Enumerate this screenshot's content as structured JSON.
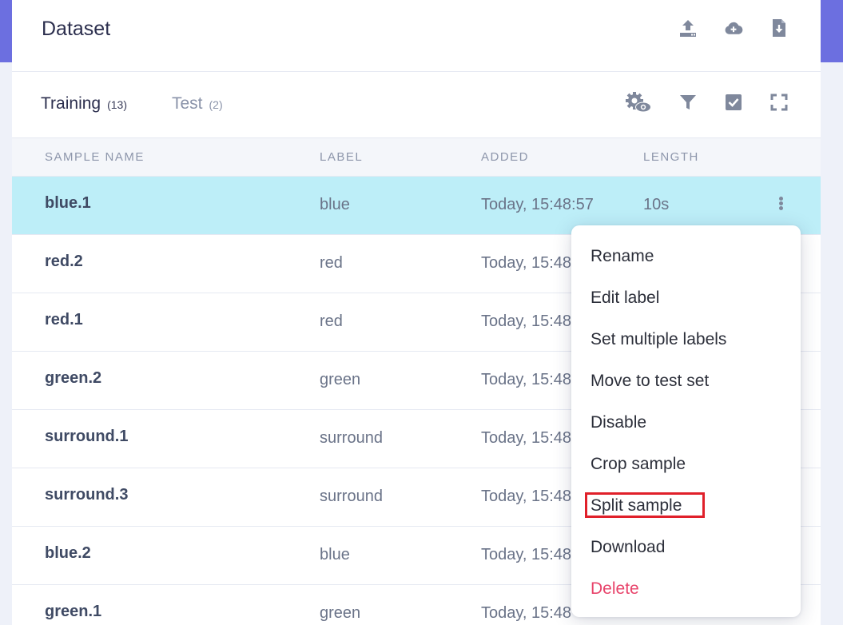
{
  "header": {
    "title": "Dataset",
    "icons": [
      "upload-icon",
      "cloud-add-icon",
      "download-file-icon"
    ]
  },
  "tabs": [
    {
      "label": "Training",
      "count": "(13)",
      "active": true
    },
    {
      "label": "Test",
      "count": "(2)",
      "active": false
    }
  ],
  "tab_tools": [
    "settings-eye-icon",
    "filter-icon",
    "select-all-checkbox-icon",
    "fullscreen-icon"
  ],
  "table": {
    "columns": [
      "SAMPLE NAME",
      "LABEL",
      "ADDED",
      "LENGTH"
    ],
    "rows": [
      {
        "name": "blue.1",
        "label": "blue",
        "added": "Today, 15:48:57",
        "length": "10s",
        "selected": true
      },
      {
        "name": "red.2",
        "label": "red",
        "added": "Today, 15:48",
        "length": ""
      },
      {
        "name": "red.1",
        "label": "red",
        "added": "Today, 15:48",
        "length": ""
      },
      {
        "name": "green.2",
        "label": "green",
        "added": "Today, 15:48",
        "length": ""
      },
      {
        "name": "surround.1",
        "label": "surround",
        "added": "Today, 15:48",
        "length": ""
      },
      {
        "name": "surround.3",
        "label": "surround",
        "added": "Today, 15:48",
        "length": ""
      },
      {
        "name": "blue.2",
        "label": "blue",
        "added": "Today, 15:48",
        "length": ""
      },
      {
        "name": "green.1",
        "label": "green",
        "added": "Today, 15:48",
        "length": ""
      }
    ]
  },
  "context_menu": {
    "items": [
      {
        "label": "Rename"
      },
      {
        "label": "Edit label"
      },
      {
        "label": "Set multiple labels"
      },
      {
        "label": "Move to test set"
      },
      {
        "label": "Disable"
      },
      {
        "label": "Crop sample"
      },
      {
        "label": "Split sample",
        "highlighted": true
      },
      {
        "label": "Download"
      },
      {
        "label": "Delete",
        "danger": true
      }
    ]
  },
  "colors": {
    "accent": "#6c6fe0",
    "selected_row": "#bdeef8",
    "danger": "#e8446b",
    "highlight": "#e0202a",
    "icon": "#7f889c"
  }
}
